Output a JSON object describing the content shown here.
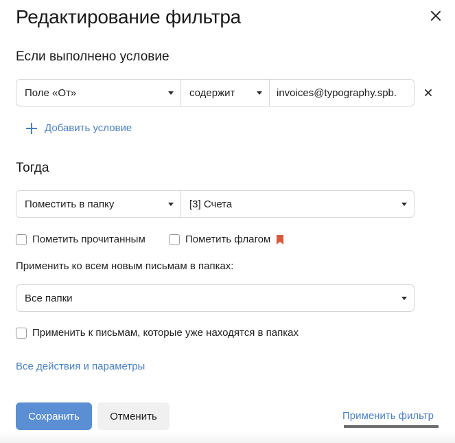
{
  "dialog": {
    "title": "Редактирование фильтра"
  },
  "condition_section": {
    "title": "Если выполнено условие",
    "field": "Поле «От»",
    "operator": "содержит",
    "value": "invoices@typography.spb.",
    "add_label": "Добавить условие"
  },
  "action_section": {
    "title": "Тогда",
    "action": "Поместить в папку",
    "folder": "[3] Счета",
    "mark_read_label": "Пометить прочитанным",
    "mark_read_checked": false,
    "mark_flag_label": "Пометить флагом",
    "mark_flag_checked": false,
    "apply_folders_label": "Применить ко всем новым письмам в папках:",
    "folders_value": "Все папки",
    "apply_existing_label": "Применить к письмам, которые уже находятся в папках",
    "apply_existing_checked": false,
    "all_actions_link": "Все действия и параметры"
  },
  "footer": {
    "save_label": "Сохранить",
    "cancel_label": "Отменить",
    "apply_label": "Применить фильтр"
  },
  "colors": {
    "accent": "#5b8fd3",
    "link": "#4a7fc1",
    "flag": "#d9573b"
  },
  "icons": {
    "close": "close-icon",
    "add": "plus-icon",
    "remove": "close-small-icon",
    "flag": "bookmark-flag-icon",
    "dropdown": "caret-down-icon"
  }
}
